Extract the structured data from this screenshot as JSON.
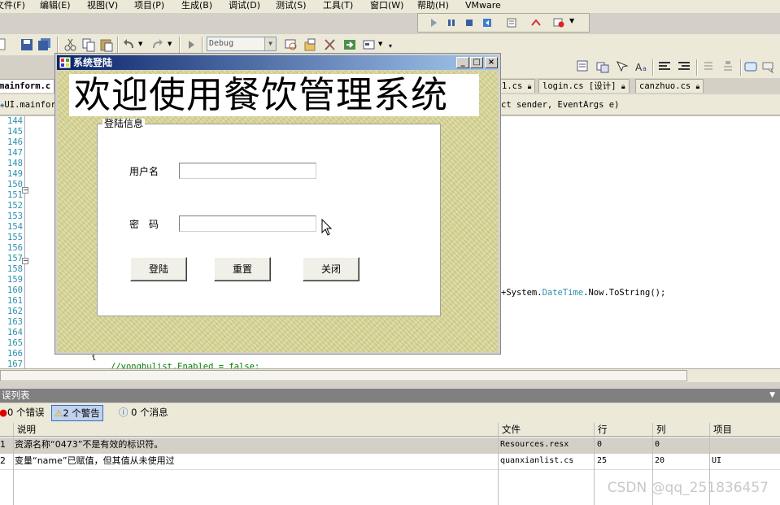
{
  "menu": {
    "items": [
      "文件(F)",
      "编辑(E)",
      "视图(V)",
      "项目(P)",
      "生成(B)",
      "调试(D)",
      "测试(S)",
      "工具(T)",
      "窗口(W)",
      "帮助(H)",
      "VMware"
    ]
  },
  "toolbar": {
    "config_combo": "Debug"
  },
  "tabs": [
    {
      "label": "mainform.c"
    },
    {
      "label": "1.cs"
    },
    {
      "label": "login.cs [设计]"
    },
    {
      "label": "canzhuo.cs"
    }
  ],
  "nav": {
    "left": "UI.mainforr",
    "right": "ct sender, EventArgs e)"
  },
  "editor": {
    "line_numbers": [
      "144",
      "145",
      "146",
      "147",
      "148",
      "149",
      "150",
      "151",
      "152",
      "153",
      "154",
      "155",
      "156",
      "157",
      "158",
      "159",
      "160",
      "161",
      "162",
      "163",
      "164",
      "165",
      "166",
      "167"
    ],
    "code_line_160_prefix": "+System.",
    "code_line_160_type": "DateTime",
    "code_line_160_suffix": ".Now.ToString();",
    "code_line_166": "{",
    "code_line_167": "//yonghulist.Enabled = false;"
  },
  "dialog": {
    "title": "系统登陆",
    "banner": "欢迎使用餐饮管理系统",
    "group_title": "登陆信息",
    "username_label": "用户名",
    "password_label": "密　码",
    "username_value": "",
    "password_value": "",
    "login_button": "登陆",
    "reset_button": "重置",
    "close_button": "关闭",
    "min_glyph": "_",
    "max_glyph": "□",
    "close_glyph": "×"
  },
  "error_list": {
    "title": "误列表",
    "errors_filter": "0 个错误",
    "warnings_filter": "2 个警告",
    "messages_filter": "0 个消息",
    "columns": {
      "desc": "说明",
      "file": "文件",
      "line": "行",
      "col": "列",
      "project": "项目"
    },
    "rows": [
      {
        "num": "1",
        "desc": "资源名称“0473”不是有效的标识符。",
        "file": "Resources.resx",
        "line": "0",
        "col": "0",
        "project": ""
      },
      {
        "num": "2",
        "desc": "变量“name”已赋值，但其值从未使用过",
        "file": "quanxianlist.cs",
        "line": "25",
        "col": "20",
        "project": "UI"
      }
    ]
  },
  "watermark": "CSDN @qq_251836457"
}
